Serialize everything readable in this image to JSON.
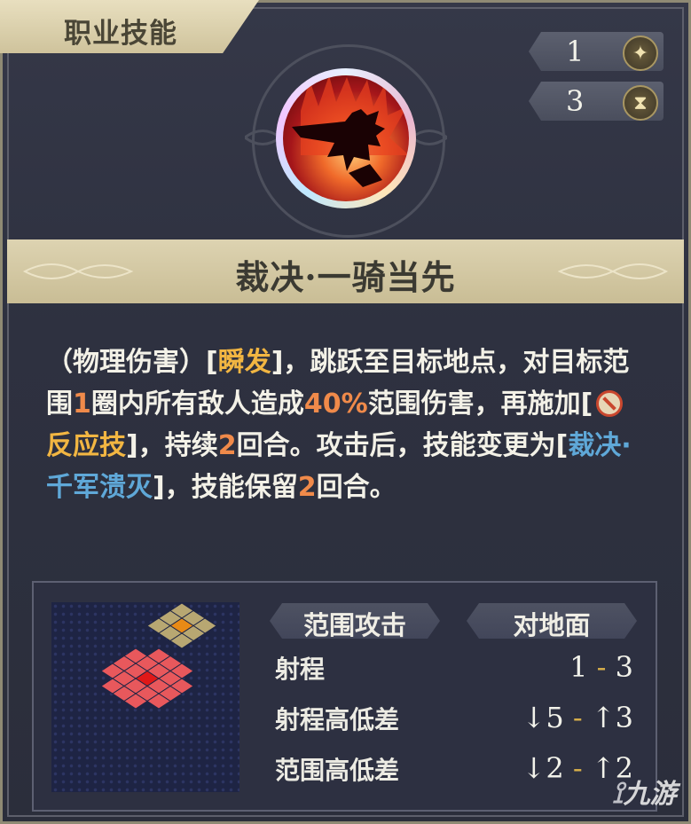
{
  "header": {
    "tab_label": "职业技能"
  },
  "stats": [
    {
      "value": "1",
      "icon": "sparkle-icon",
      "glyph": "✦"
    },
    {
      "value": "3",
      "icon": "hourglass-icon",
      "glyph": "⧗"
    }
  ],
  "skill": {
    "name": "裁决·一骑当先",
    "desc": {
      "p1": "（物理伤害）[",
      "instant": "瞬发",
      "p2": "]，跳跃至目标地点，对目标范围",
      "radius": "1",
      "p3": "圈内所有敌人造成",
      "dmg_pct": "40%",
      "p4": "范围伤害，再施加[",
      "reaction": "反应技",
      "p5": "]，持续",
      "dur1": "2",
      "p6": "回合。攻击后，技能变更为[",
      "changed": "裁决·千军溃灭",
      "p7": "]，技能保留",
      "dur2": "2",
      "p8": "回合。"
    }
  },
  "tags": {
    "left": "范围攻击",
    "right": "对地面"
  },
  "rows": [
    {
      "label": "射程",
      "from": "1",
      "to": "3"
    },
    {
      "label": "射程高低差",
      "from": "↓5",
      "to": "↑3"
    },
    {
      "label": "范围高低差",
      "from": "↓2",
      "to": "↑2"
    }
  ],
  "watermark": "九游",
  "colors": {
    "accent_orange": "#f08a4a",
    "accent_gold": "#f2b642",
    "accent_blue": "#5fa8d8",
    "area_red": "#e8585c",
    "area_center": "#e01818",
    "area_tan": "#b8a772",
    "area_target": "#e88a16"
  }
}
